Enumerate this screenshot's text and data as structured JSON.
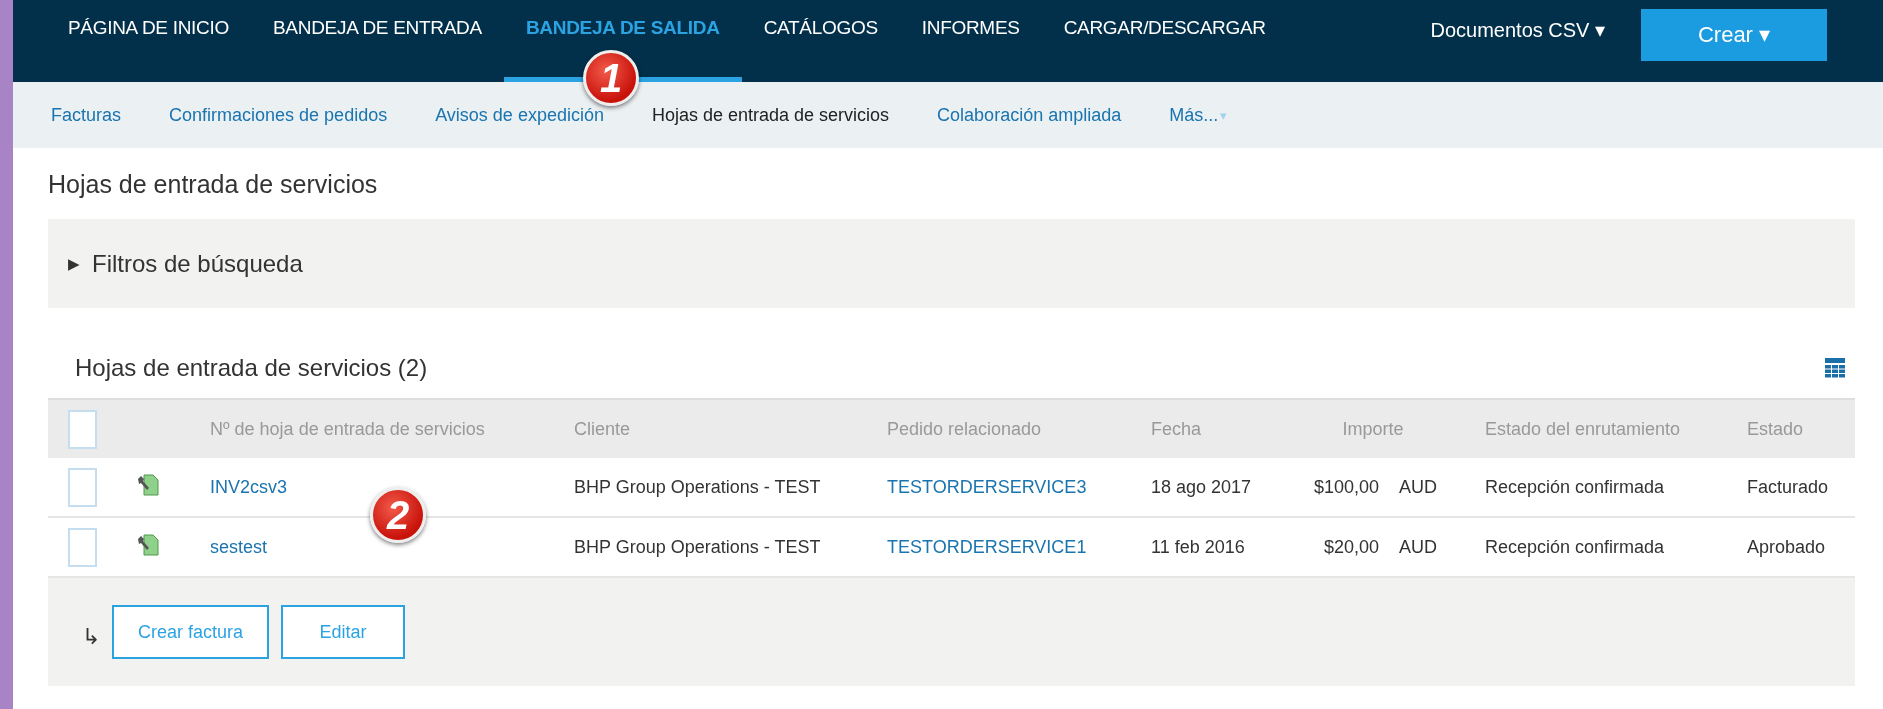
{
  "top_nav": {
    "items": [
      {
        "label": "PÁGINA DE INICIO",
        "selected": false
      },
      {
        "label": "BANDEJA DE ENTRADA",
        "selected": false
      },
      {
        "label": "BANDEJA DE SALIDA",
        "selected": true
      },
      {
        "label": "CATÁLOGOS",
        "selected": false
      },
      {
        "label": "INFORMES",
        "selected": false
      },
      {
        "label": "CARGAR/DESCARGAR",
        "selected": false
      }
    ],
    "documents_menu": "Documentos CSV ▾",
    "create_button": "Crear ▾"
  },
  "sub_nav": {
    "items": [
      {
        "label": "Facturas",
        "selected": false
      },
      {
        "label": "Confirmaciones de pedidos",
        "selected": false
      },
      {
        "label": "Avisos de expedición",
        "selected": false
      },
      {
        "label": "Hojas de entrada de servicios",
        "selected": true
      },
      {
        "label": "Colaboración ampliada",
        "selected": false
      }
    ],
    "more": "Más...",
    "more_caret": "▾"
  },
  "page_title": "Hojas de entrada de servicios",
  "filters": {
    "label": "Filtros de búsqueda",
    "expanded": false,
    "toggle": "▶"
  },
  "table": {
    "title": "Hojas de entrada de servicios (2)",
    "select_all": {
      "checked": false
    },
    "columns": [
      "Nº de hoja de entrada de servicios",
      "Cliente",
      "Pedido relacionado",
      "Fecha",
      "Importe",
      "Estado del enrutamiento",
      "Estado"
    ],
    "rows": [
      {
        "checked": false,
        "number": "INV2csv3",
        "customer": "BHP Group Operations - TEST",
        "order": "TESTORDERSERVICE3",
        "date": "18 ago 2017",
        "amount": "$100,00",
        "currency": "AUD",
        "routing_status": "Recepción confirmada",
        "status": "Facturado"
      },
      {
        "checked": false,
        "number": "sestest",
        "customer": "BHP Group Operations - TEST",
        "order": "TESTORDERSERVICE1",
        "date": "11 feb 2016",
        "amount": "$20,00",
        "currency": "AUD",
        "routing_status": "Recepción confirmada",
        "status": "Aprobado"
      }
    ],
    "footer": {
      "arrow": "↳",
      "buttons": [
        "Crear factura",
        "Editar"
      ]
    }
  },
  "callouts": [
    "1",
    "2"
  ]
}
